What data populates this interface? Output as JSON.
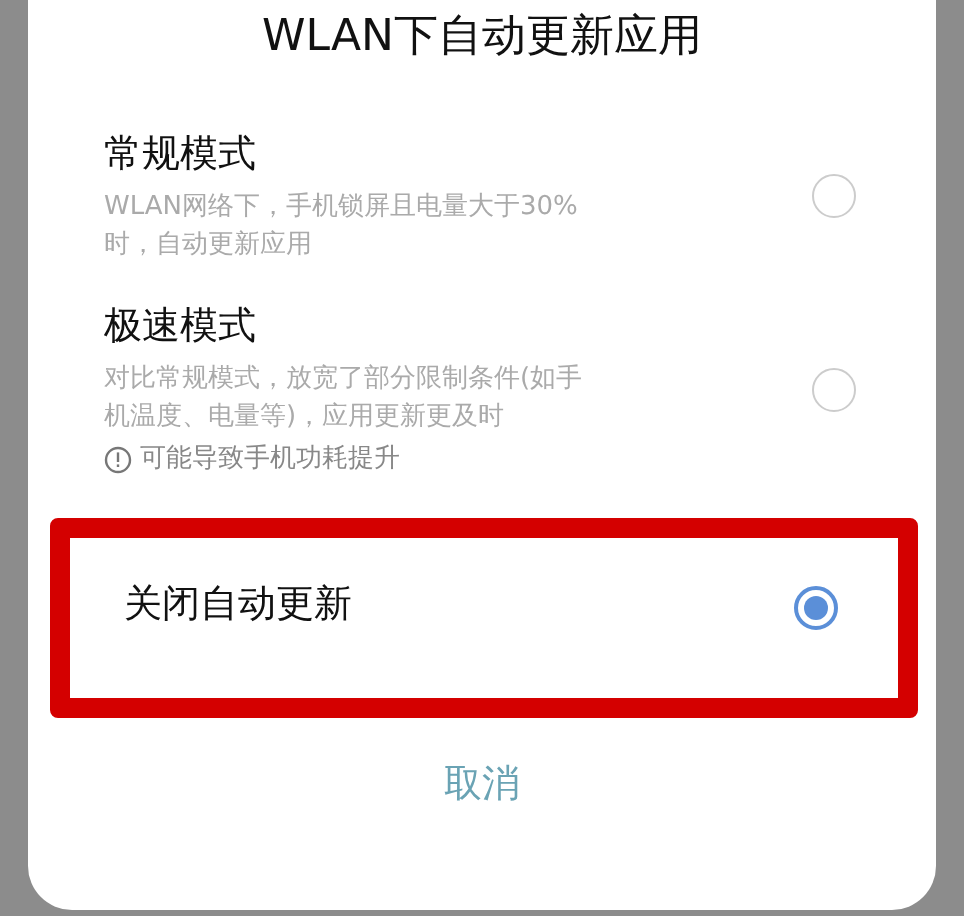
{
  "dialog": {
    "title": "WLAN下自动更新应用",
    "options": [
      {
        "title": "常规模式",
        "description": "WLAN网络下，手机锁屏且电量大于30%时，自动更新应用",
        "selected": false,
        "highlighted": false
      },
      {
        "title": "极速模式",
        "description": "对比常规模式，放宽了部分限制条件(如手机温度、电量等)，应用更新更及时",
        "warning": "可能导致手机功耗提升",
        "selected": false,
        "highlighted": false
      },
      {
        "title": "关闭自动更新",
        "selected": true,
        "highlighted": true
      }
    ],
    "cancel_button": "取消"
  }
}
